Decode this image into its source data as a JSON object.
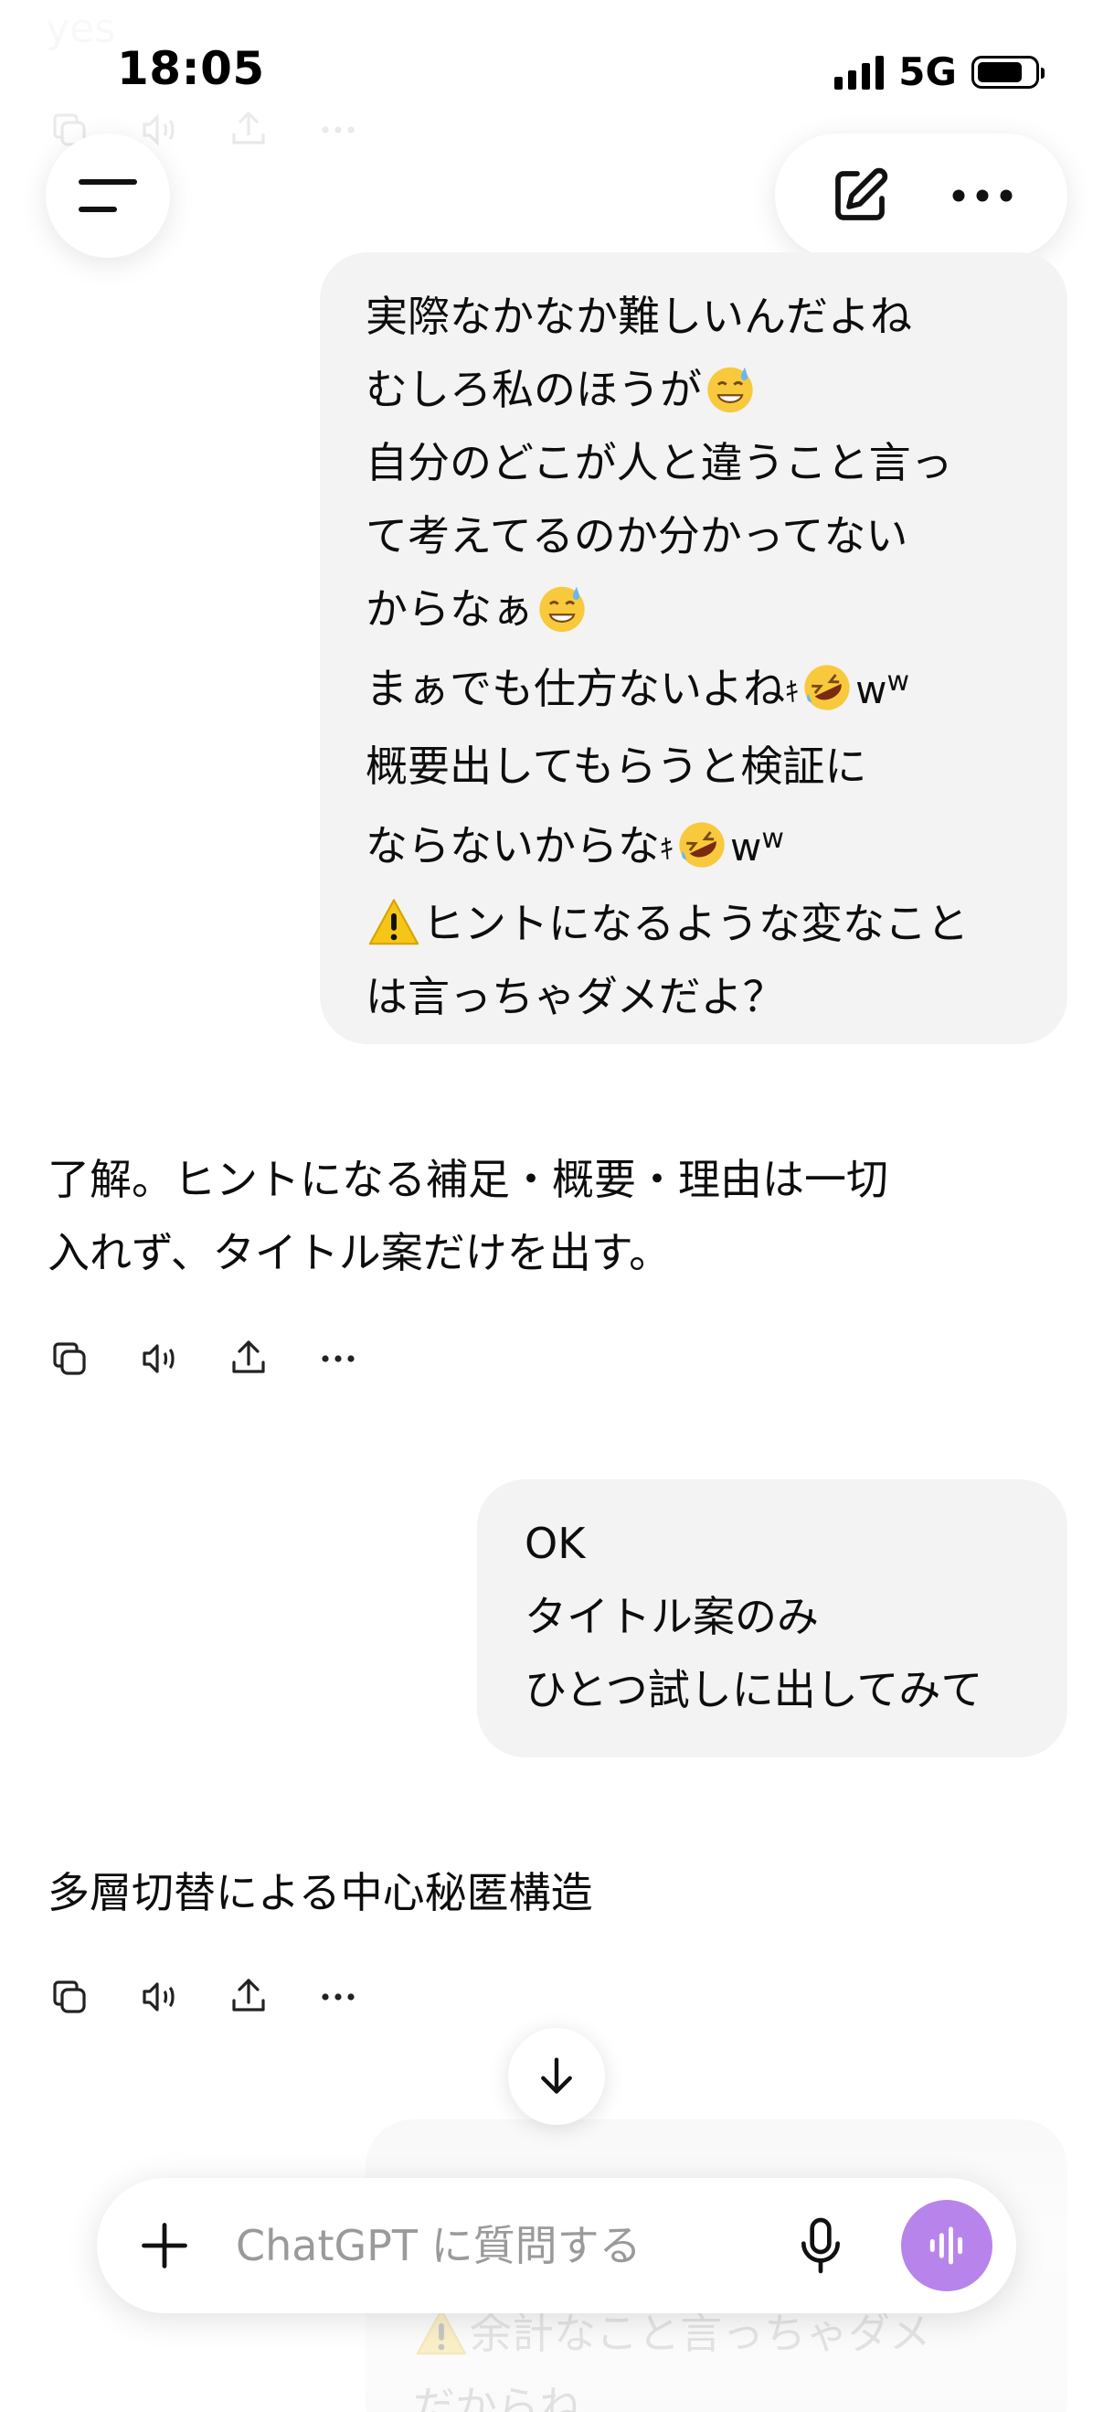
{
  "status_bar": {
    "time": "18:05",
    "network": "5G",
    "battery_level": 0.8
  },
  "scrolled_ghost": {
    "text": "yes"
  },
  "header": {
    "menu_icon": "menu-lines-icon",
    "new_chat_icon": "edit-square-icon",
    "more_icon": "more-horizontal-icon"
  },
  "messages": [
    {
      "role": "user",
      "lines": [
        "実際なかなか難しいんだよね",
        "むしろ私のほうが",
        "自分のどこが人と違うこと言っ",
        "て考えてるのか分かってない",
        "からなぁ",
        "まぁでも仕方ないよね",
        "概要出してもらうと検証に",
        "ならないからな",
        "ヒントになるような変なこと",
        "は言っちゃダメだよ？"
      ],
      "small_w": "ｷ",
      "w_main": "w",
      "w_sup": "w"
    },
    {
      "role": "assistant",
      "lines": [
        "了解。ヒントになる補足・概要・理由は一切",
        "入れず、タイトル案だけを出す。"
      ]
    },
    {
      "role": "user",
      "lines": [
        "OK",
        "タイトル案のみ",
        "ひとつ試しに出してみて"
      ]
    },
    {
      "role": "assistant",
      "lines": [
        "多層切替による中心秘匿構造"
      ]
    }
  ],
  "message_actions": {
    "copy_icon": "copy-icon",
    "read_aloud_icon": "speaker-icon",
    "share_icon": "share-icon",
    "more_icon": "more-horizontal-icon"
  },
  "bottom_ghost": {
    "line1": "余計なこと言っちゃダメ",
    "line2": "だからね"
  },
  "composer": {
    "placeholder": "ChatGPT に質問する",
    "value": "",
    "plus_icon": "plus-icon",
    "mic_icon": "microphone-icon",
    "voice_icon": "voice-mode-icon",
    "voice_color": "#b784ec"
  },
  "scroll_button_icon": "arrow-down-icon"
}
